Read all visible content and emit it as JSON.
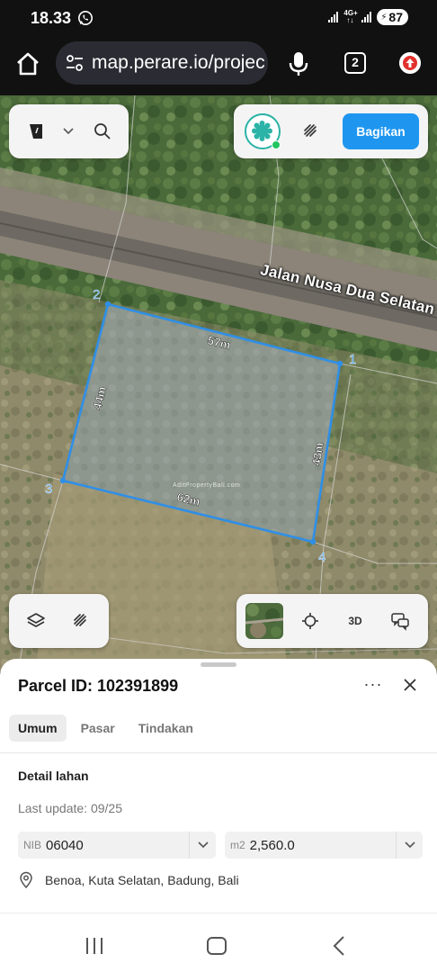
{
  "status_bar": {
    "time": "18.33",
    "network_label_top": "4G+",
    "network_label_bottom": "↑↓",
    "battery": "87",
    "icons": [
      "whatsapp-icon",
      "signal-icon",
      "battery-icon"
    ]
  },
  "browser": {
    "url": "map.perare.io/projec",
    "tab_count": "2",
    "icons": [
      "home-icon",
      "tune-icon",
      "mic-icon",
      "update-icon"
    ]
  },
  "map": {
    "road_label": "Jalan Nusa Dua Selatan",
    "watermark": "AditPropertyBali.com",
    "parcel_vertices": [
      {
        "label": "1"
      },
      {
        "label": "2"
      },
      {
        "label": "3"
      },
      {
        "label": "4"
      }
    ],
    "edge_lengths": [
      "57m",
      "44m",
      "62m",
      "43m"
    ],
    "parcel_color": "#2f8fe6"
  },
  "toolbar": {
    "share_label": "Bagikan",
    "share_color": "#1e96f0",
    "active_color": "#2ab3a6",
    "icons": [
      "ruler-icon",
      "chevron-down-icon",
      "search-icon",
      "layer-filter-icon",
      "draw-icon",
      "layers-icon",
      "measure-icon",
      "satellite-thumbnail",
      "locate-icon",
      "feedback-icon"
    ],
    "btn_3d": "3D"
  },
  "sheet": {
    "parcel_title": "Parcel ID: 102391899",
    "more_label": "···",
    "tabs": [
      {
        "label": "Umum",
        "active": true
      },
      {
        "label": "Pasar",
        "active": false
      },
      {
        "label": "Tindakan",
        "active": false
      }
    ],
    "section_title": "Detail lahan",
    "last_update": "Last update: 09/25",
    "nib": {
      "prefix": "NIB",
      "value": "06040"
    },
    "area": {
      "prefix": "m2",
      "value": "2,560.0"
    },
    "location": "Benoa, Kuta Selatan, Badung, Bali"
  },
  "nav": {
    "icons": [
      "recent-apps-icon",
      "home-button-icon",
      "back-icon"
    ]
  }
}
